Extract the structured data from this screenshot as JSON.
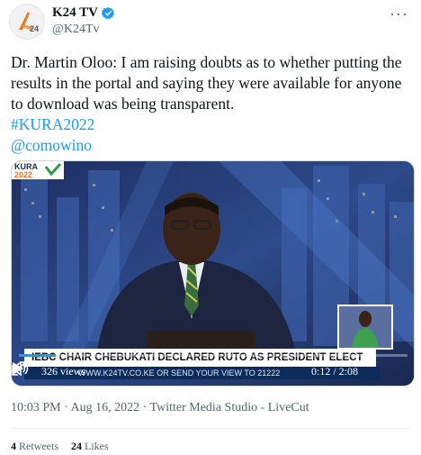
{
  "author": {
    "name": "K24 TV",
    "handle": "@K24Tv",
    "verified": true,
    "avatar_icon": "k24-logo-icon",
    "more_label": "···"
  },
  "tweet": {
    "text": "Dr. Martin Oloo: I am raising doubts as to whether putting the results in the portal and saying they were available for anyone to download was being transparent.",
    "hashtag": "#KURA2022",
    "mention": "@comowino"
  },
  "video": {
    "brand": "KURA 2022",
    "headline": "IEBC CHAIR CHEBUKATI DECLARED RUTO AS PRESIDENT ELECT",
    "ticker": "WWW.K24TV.CO.KE OR SEND YOUR VIEW TO 21222",
    "views": "326 views",
    "time": "0:12 / 2:08",
    "progress": 0.094
  },
  "meta": {
    "timestamp": "10:03 PM · Aug 16, 2022 · Twitter Media Studio - LiveCut"
  },
  "stats": {
    "retweets_count": "4",
    "retweets_label": "Retweets",
    "likes_count": "24",
    "likes_label": "Likes"
  },
  "colors": {
    "link": "#1d9bf0",
    "secondary": "#536471",
    "studio_blue": "#1b2c57"
  }
}
